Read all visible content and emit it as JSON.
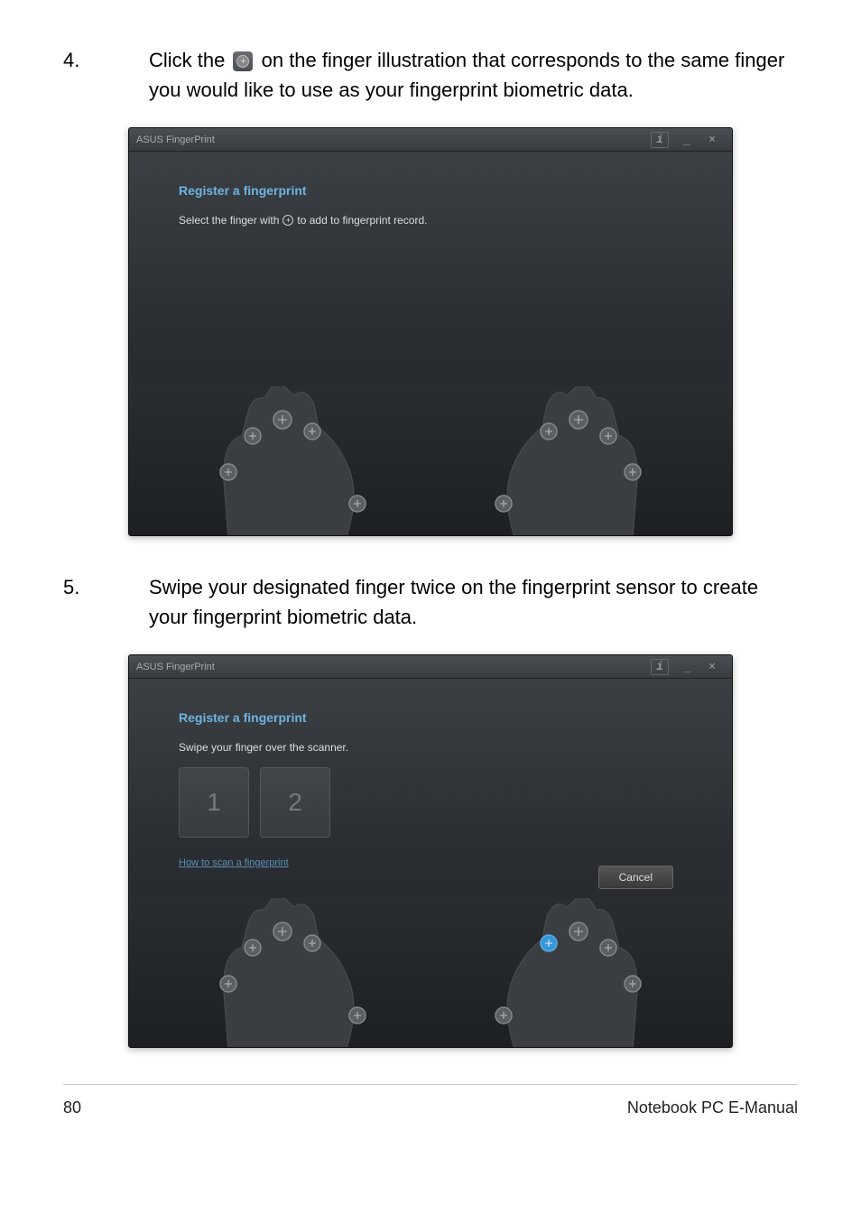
{
  "steps": {
    "s4": {
      "num": "4.",
      "pre": "Click the",
      "post": "on the finger illustration that corresponds to the same finger you would like to use as your fingerprint biometric data."
    },
    "s5": {
      "num": "5.",
      "text": "Swipe your designated finger twice on the fingerprint sensor to create your fingerprint biometric data."
    }
  },
  "window": {
    "title": "ASUS FingerPrint",
    "info": "i",
    "min": "_",
    "close": "×"
  },
  "screen1": {
    "heading": "Register a fingerprint",
    "instruction_pre": "Select the finger with",
    "instruction_post": "to add to fingerprint record."
  },
  "screen2": {
    "heading": "Register a fingerprint",
    "instruction": "Swipe your finger over the scanner.",
    "box1": "1",
    "box2": "2",
    "help_link": "How to scan a fingerprint",
    "cancel": "Cancel"
  },
  "footer": {
    "page": "80",
    "doc": "Notebook PC E-Manual"
  }
}
